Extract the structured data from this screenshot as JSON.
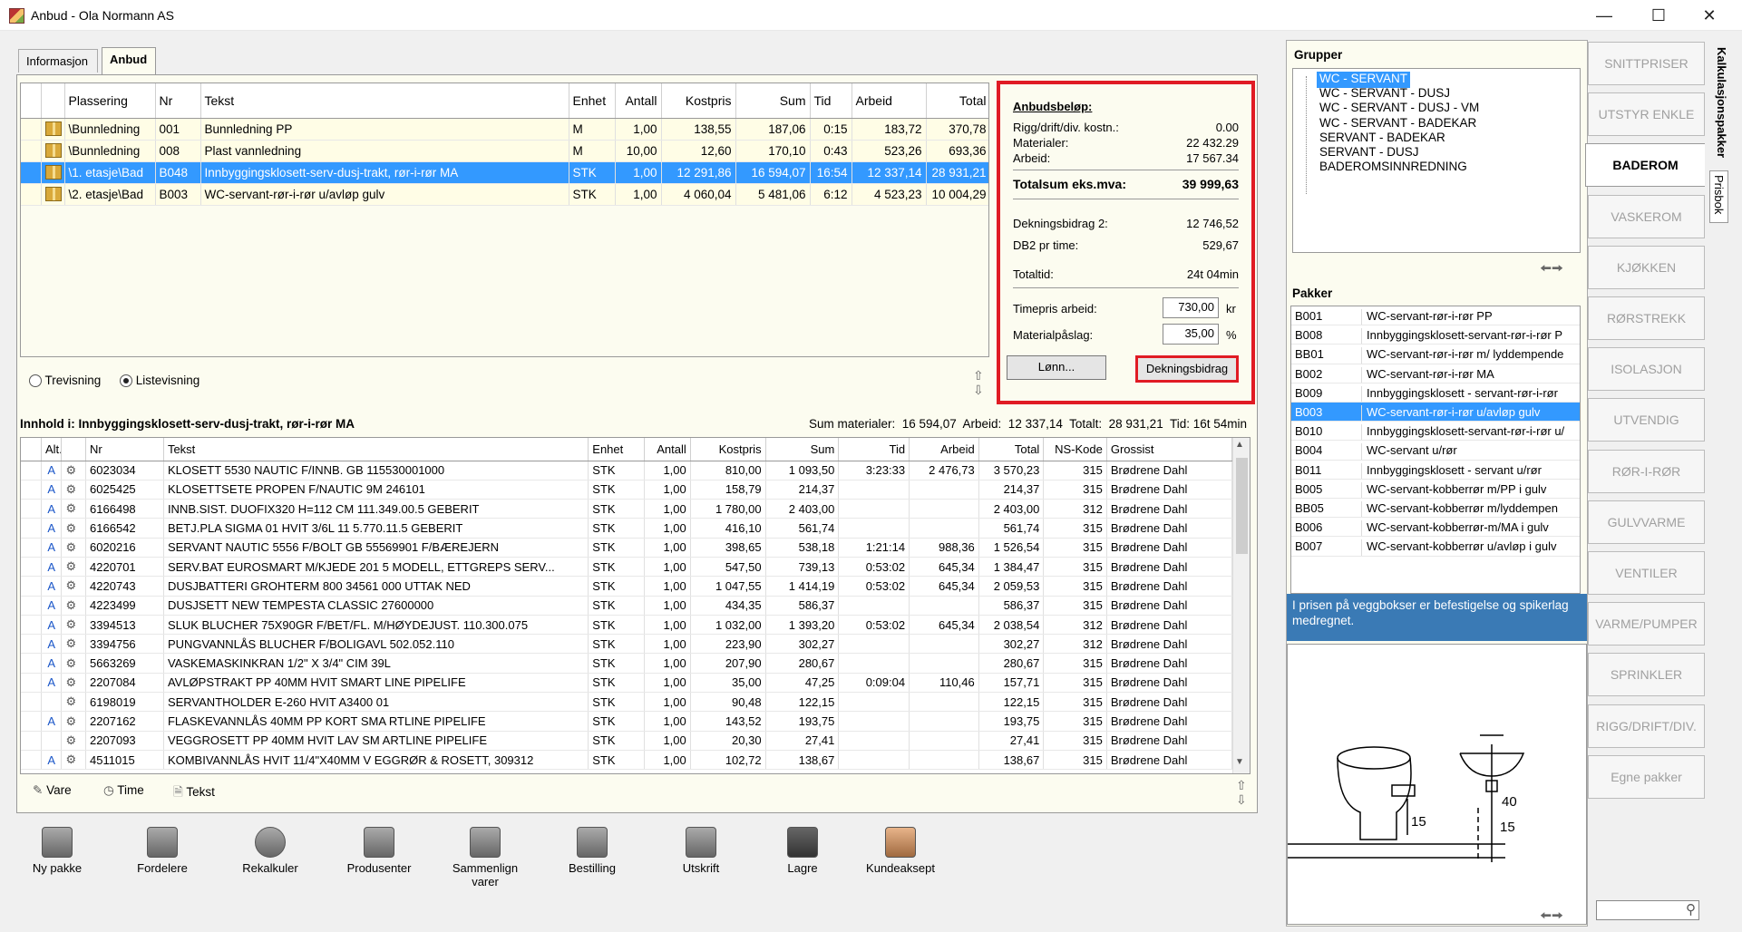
{
  "window": {
    "title": "Anbud - Ola Normann AS"
  },
  "tabs": [
    "Informasjon",
    "Anbud"
  ],
  "top_table": {
    "headers": [
      "Plassering",
      "Nr",
      "Tekst",
      "Enhet",
      "Antall",
      "Kostpris",
      "Sum",
      "Tid",
      "Arbeid",
      "Total"
    ],
    "rows": [
      [
        "\\Bunnledning",
        "001",
        "Bunnledning PP",
        "M",
        "1,00",
        "138,55",
        "187,06",
        "0:15",
        "183,72",
        "370,78"
      ],
      [
        "\\Bunnledning",
        "008",
        "Plast vannledning",
        "M",
        "10,00",
        "12,60",
        "170,10",
        "0:43",
        "523,26",
        "693,36"
      ],
      [
        "\\1. etasje\\Bad",
        "B048",
        "Innbyggingsklosett-serv-dusj-trakt, rør-i-rør MA",
        "STK",
        "1,00",
        "12 291,86",
        "16 594,07",
        "16:54",
        "12 337,14",
        "28 931,21"
      ],
      [
        "\\2. etasje\\Bad",
        "B003",
        "WC-servant-rør-i-rør u/avløp gulv",
        "STK",
        "1,00",
        "4 060,04",
        "5 481,06",
        "6:12",
        "4 523,23",
        "10 004,29"
      ]
    ]
  },
  "summary": {
    "heading": "Anbudsbeløp:",
    "rigg_label": "Rigg/drift/div. kostn.:",
    "rigg": "0.00",
    "mat_label": "Materialer:",
    "mat": "22 432.29",
    "arb_label": "Arbeid:",
    "arb": "17 567.34",
    "total_label": "Totalsum eks.mva:",
    "total": "39 999,63",
    "db2_label": "Dekningsbidrag 2:",
    "db2": "12 746,52",
    "db2t_label": "DB2 pr time:",
    "db2t": "529,67",
    "tid_label": "Totaltid:",
    "tid": "24t 04min",
    "timepris_label": "Timepris arbeid:",
    "timepris": "730,00",
    "timepris_unit": "kr",
    "pasl_label": "Materialpåslag:",
    "pasl": "35,00",
    "pasl_unit": "%",
    "lonn_btn": "Lønn...",
    "db_btn": "Dekningsbidrag"
  },
  "view": {
    "tre": "Trevisning",
    "liste": "Listevisning"
  },
  "content": {
    "title": "Innhold i: Innbyggingsklosett-serv-dusj-trakt, rør-i-rør MA",
    "sums": "Sum materialer:  16 594,07  Arbeid:  12 337,14  Totalt:  28 931,21  Tid: 16t 54min",
    "headers": [
      "Alt.",
      "Nr",
      "Tekst",
      "Enhet",
      "Antall",
      "Kostpris",
      "Sum",
      "Tid",
      "Arbeid",
      "Total",
      "NS-Kode",
      "Grossist"
    ],
    "rows": [
      [
        "A",
        "6023034",
        "KLOSETT 5530 NAUTIC F/INNB. GB 115530001000",
        "STK",
        "1,00",
        "810,00",
        "1 093,50",
        "3:23:33",
        "2 476,73",
        "3 570,23",
        "315",
        "Brødrene Dahl"
      ],
      [
        "A",
        "6025425",
        "KLOSETTSETE PROPEN F/NAUTIC 9M 246101",
        "STK",
        "1,00",
        "158,79",
        "214,37",
        "",
        "",
        "214,37",
        "315",
        "Brødrene Dahl"
      ],
      [
        "A",
        "6166498",
        "INNB.SIST. DUOFIX320 H=112 CM 111.349.00.5 GEBERIT",
        "STK",
        "1,00",
        "1 780,00",
        "2 403,00",
        "",
        "",
        "2 403,00",
        "312",
        "Brødrene Dahl"
      ],
      [
        "A",
        "6166542",
        "BETJ.PLA SIGMA 01 HVIT 3/6L 11 5.770.11.5 GEBERIT",
        "STK",
        "1,00",
        "416,10",
        "561,74",
        "",
        "",
        "561,74",
        "315",
        "Brødrene Dahl"
      ],
      [
        "A",
        "6020216",
        "SERVANT NAUTIC 5556 F/BOLT GB 55569901 F/BÆREJERN",
        "STK",
        "1,00",
        "398,65",
        "538,18",
        "1:21:14",
        "988,36",
        "1 526,54",
        "315",
        "Brødrene Dahl"
      ],
      [
        "A",
        "4220701",
        "SERV.BAT EUROSMART M/KJEDE 201 5 MODELL, ETTGREPS SERV...",
        "STK",
        "1,00",
        "547,50",
        "739,13",
        "0:53:02",
        "645,34",
        "1 384,47",
        "315",
        "Brødrene Dahl"
      ],
      [
        "A",
        "4220743",
        "DUSJBATTERI GROHTERM 800 34561 000 UTTAK NED",
        "STK",
        "1,00",
        "1 047,55",
        "1 414,19",
        "0:53:02",
        "645,34",
        "2 059,53",
        "315",
        "Brødrene Dahl"
      ],
      [
        "A",
        "4223499",
        "DUSJSETT NEW TEMPESTA CLASSIC 27600000",
        "STK",
        "1,00",
        "434,35",
        "586,37",
        "",
        "",
        "586,37",
        "315",
        "Brødrene Dahl"
      ],
      [
        "A",
        "3394513",
        "SLUK BLUCHER 75X90GR F/BET/FL. M/HØYDEJUST.      110.300.075",
        "STK",
        "1,00",
        "1 032,00",
        "1 393,20",
        "0:53:02",
        "645,34",
        "2 038,54",
        "312",
        "Brødrene Dahl"
      ],
      [
        "A",
        "3394756",
        "PUNGVANNLÅS BLUCHER F/BOLIGAVL 502.052.110",
        "STK",
        "1,00",
        "223,90",
        "302,27",
        "",
        "",
        "302,27",
        "312",
        "Brødrene Dahl"
      ],
      [
        "A",
        "5663269",
        "VASKEMASKINKRAN    1/2\" X 3/4\" CIM 39L",
        "STK",
        "1,00",
        "207,90",
        "280,67",
        "",
        "",
        "280,67",
        "315",
        "Brødrene Dahl"
      ],
      [
        "A",
        "2207084",
        "AVLØPSTRAKT PP 40MM HVIT SMART LINE PIPELIFE",
        "STK",
        "1,00",
        "35,00",
        "47,25",
        "0:09:04",
        "110,46",
        "157,71",
        "315",
        "Brødrene Dahl"
      ],
      [
        "",
        "6198019",
        "SERVANTHOLDER E-260 HVIT A3400 01",
        "STK",
        "1,00",
        "90,48",
        "122,15",
        "",
        "",
        "122,15",
        "315",
        "Brødrene Dahl"
      ],
      [
        "A",
        "2207162",
        "FLASKEVANNLÅS 40MM PP KORT SMA RTLINE PIPELIFE",
        "STK",
        "1,00",
        "143,52",
        "193,75",
        "",
        "",
        "193,75",
        "315",
        "Brødrene Dahl"
      ],
      [
        "",
        "2207093",
        "VEGGROSETT PP 40MM HVIT LAV SM ARTLINE PIPELIFE",
        "STK",
        "1,00",
        "20,30",
        "27,41",
        "",
        "",
        "27,41",
        "315",
        "Brødrene Dahl"
      ],
      [
        "A",
        "4511015",
        "KOMBIVANNLÅS HVIT 11/4\"X40MM V EGGRØR & ROSETT, 309312",
        "STK",
        "1,00",
        "102,72",
        "138,67",
        "",
        "",
        "138,67",
        "315",
        "Brødrene Dahl"
      ]
    ]
  },
  "filters": {
    "vare": "Vare",
    "time": "Time",
    "tekst": "Tekst"
  },
  "toolbar": [
    "Ny pakke",
    "Fordelere",
    "Rekalkuler",
    "Produsenter",
    "Sammenlign\nvarer",
    "Bestilling",
    "Utskrift",
    "Lagre",
    "Kundeaksept"
  ],
  "grupper": {
    "title": "Grupper",
    "items": [
      "WC - SERVANT",
      "WC - SERVANT - DUSJ",
      "WC - SERVANT - DUSJ - VM",
      "WC - SERVANT - BADEKAR",
      "SERVANT - BADEKAR",
      "SERVANT - DUSJ",
      "BADEROMSINNREDNING"
    ]
  },
  "pakker": {
    "title": "Pakker",
    "items": [
      [
        "B001",
        "WC-servant-rør-i-rør PP"
      ],
      [
        "B008",
        "Innbyggingsklosett-servant-rør-i-rør P"
      ],
      [
        "BB01",
        "WC-servant-rør-i-rør m/ lyddempende"
      ],
      [
        "B002",
        "WC-servant-rør-i-rør MA"
      ],
      [
        "B009",
        "Innbyggingsklosett - servant-rør-i-rør"
      ],
      [
        "B003",
        "WC-servant-rør-i-rør u/avløp gulv"
      ],
      [
        "B010",
        "Innbyggingsklosett-servant-rør-i-rør u/"
      ],
      [
        "B004",
        "WC-servant u/rør"
      ],
      [
        "B011",
        "Innbyggingsklosett - servant u/rør"
      ],
      [
        "B005",
        "WC-servant-kobberrør m/PP i gulv"
      ],
      [
        "BB05",
        "WC-servant-kobberrør m/lyddempen"
      ],
      [
        "B006",
        "WC-servant-kobberrør-m/MA i gulv"
      ],
      [
        "B007",
        "WC-servant-kobberrør u/avløp i gulv"
      ]
    ]
  },
  "info": "I prisen på veggbokser er befestigelse og spikerlag medregnet.",
  "drawing": {
    "d1": "15",
    "d2": "40",
    "d3": "15"
  },
  "side_tabs": [
    "SNITTPRISER",
    "UTSTYR  ENKLE",
    "BADEROM",
    "VASKEROM",
    "KJØKKEN",
    "RØRSTREKK",
    "ISOLASJON",
    "UTVENDIG",
    "RØR-I-RØR",
    "GULVVARME",
    "VENTILER",
    "VARME/PUMPER",
    "SPRINKLER",
    "RIGG/DRIFT/DIV.",
    "Egne pakker"
  ],
  "vertical_tabs": [
    "Kalkulasjonspakker",
    "Prisbok"
  ]
}
